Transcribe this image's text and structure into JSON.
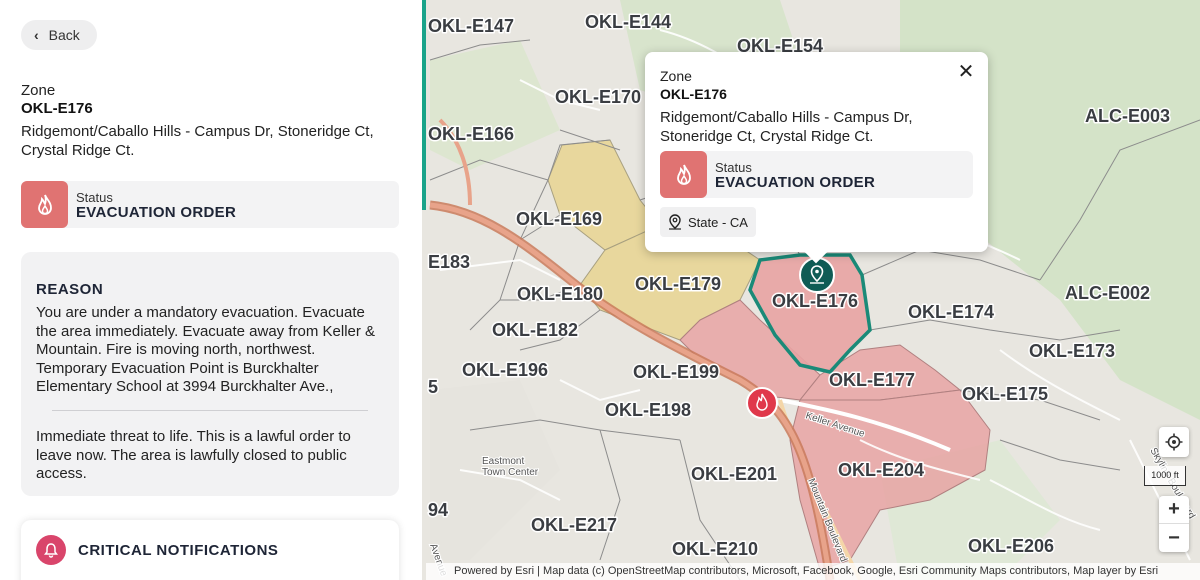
{
  "panel": {
    "back_label": "Back",
    "zone_label": "Zone",
    "zone_id": "OKL-E176",
    "zone_description": "Ridgemont/Caballo Hills - Campus Dr, Stoneridge Ct, Crystal Ridge Ct.",
    "status_label": "Status",
    "status_value": "EVACUATION ORDER",
    "reason_title": "REASON",
    "reason_text": "You are under a mandatory evacuation. Evacuate the area immediately. Evacuate away from Keller & Mountain. Fire is moving north, northwest. Temporary Evacuation Point is Burckhalter Elementary School at 3994 Burckhalter Ave.,",
    "reason_text_2": "Immediate threat to life. This is a lawful order to leave now. The area is lawfully closed to public access.",
    "notifications_title": "CRITICAL NOTIFICATIONS"
  },
  "popup": {
    "zone_label": "Zone",
    "zone_id": "OKL-E176",
    "zone_description": "Ridgemont/Caballo Hills - Campus Dr, Stoneridge Ct, Crystal Ridge Ct.",
    "status_label": "Status",
    "status_value": "EVACUATION ORDER",
    "state_chip": "State - CA",
    "close_icon": "close-icon"
  },
  "map": {
    "zone_labels": [
      "OKL-E147",
      "OKL-E144",
      "OKL-E154",
      "OKL-E170",
      "OKL-E166",
      "ALC-E003",
      "OKL-E169",
      "E183",
      "OKL-E179",
      "OKL-E180",
      "OKL-E176",
      "ALC-E002",
      "OKL-E182",
      "OKL-E174",
      "OKL-E173",
      "OKL-E196",
      "OKL-E199",
      "OKL-E177",
      "OKL-E175",
      "OKL-E198",
      "OKL-E204",
      "OKL-E201",
      "OKL-E217",
      "OKL-E210",
      "OKL-E206",
      "5",
      "94"
    ],
    "street_labels": [
      "Keller Avenue",
      "Mountain Boulevard",
      "Eastmont Town Center",
      "Skyline Boulevard",
      "Avenue"
    ],
    "scale_label": "1000 ft",
    "attribution": "Powered by Esri | Map data (c) OpenStreetMap contributors, Microsoft, Facebook, Google, Esri Community Maps contributors, Map layer by Esri",
    "colors": {
      "order": "#e8a3a3",
      "warning": "#e8d490",
      "selected_outline": "#1a8a78",
      "marker": "#0f5c55",
      "fire": "#e0384b"
    }
  },
  "controls": {
    "locate_icon": "locate-icon",
    "zoom_in": "+",
    "zoom_out": "−"
  }
}
